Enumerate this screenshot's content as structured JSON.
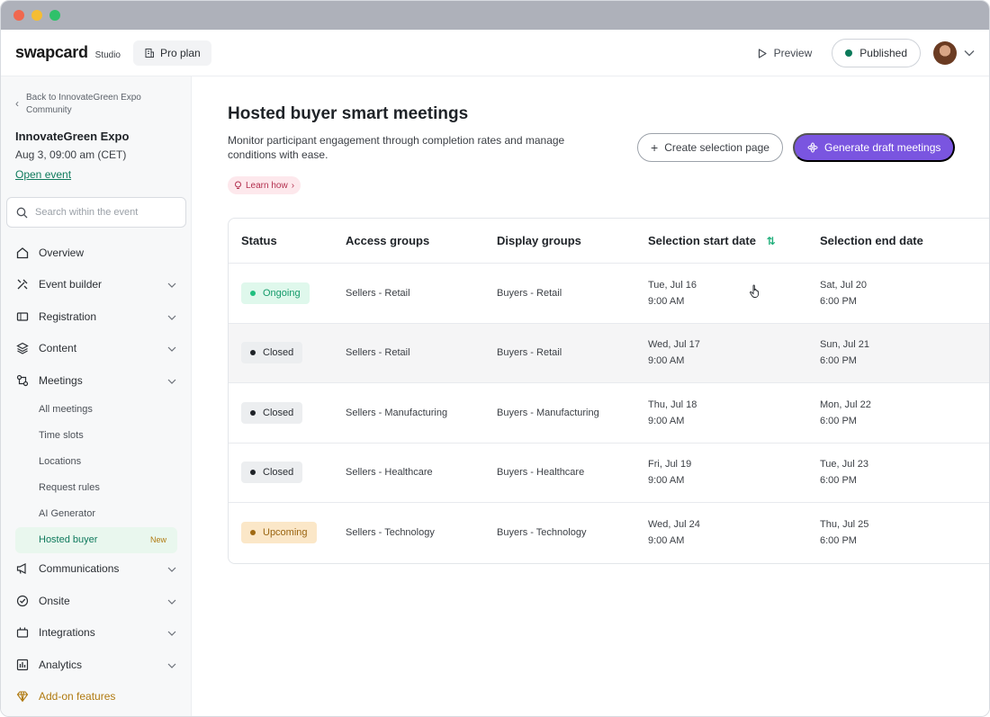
{
  "app": {
    "logo_text": "swapcard",
    "studio_label": "Studio",
    "plan_label": "Pro plan",
    "preview_label": "Preview",
    "published_label": "Published"
  },
  "sidebar": {
    "back_label": "Back to InnovateGreen Expo Community",
    "event_name": "InnovateGreen Expo",
    "event_date": "Aug 3, 09:00 am (CET)",
    "open_event_label": "Open event",
    "search_placeholder": "Search within the event",
    "items": [
      {
        "label": "Overview",
        "icon": "home-icon"
      },
      {
        "label": "Event builder",
        "icon": "tools-icon"
      },
      {
        "label": "Registration",
        "icon": "ticket-icon"
      },
      {
        "label": "Content",
        "icon": "layers-icon"
      },
      {
        "label": "Meetings",
        "icon": "meetings-icon"
      },
      {
        "label": "Communications",
        "icon": "megaphone-icon"
      },
      {
        "label": "Onsite",
        "icon": "badge-check-icon"
      },
      {
        "label": "Integrations",
        "icon": "plug-icon"
      },
      {
        "label": "Analytics",
        "icon": "chart-icon"
      },
      {
        "label": "Add-on features",
        "icon": "diamond-icon"
      }
    ],
    "meetings_sub": [
      "All meetings",
      "Time slots",
      "Locations",
      "Request rules",
      "AI Generator",
      "Hosted buyer"
    ],
    "new_badge": "New"
  },
  "main": {
    "title": "Hosted buyer smart meetings",
    "description": "Monitor participant engagement through completion rates and manage conditions with ease.",
    "learn_label": "Learn how",
    "create_btn": "Create selection page",
    "generate_btn": "Generate draft meetings"
  },
  "table": {
    "headers": [
      "Status",
      "Access groups",
      "Display groups",
      "Selection start date",
      "Selection end date"
    ],
    "rows": [
      {
        "status": "Ongoing",
        "access": "Sellers - Retail",
        "display": "Buyers - Retail",
        "start_day": "Tue, Jul 16",
        "start_time": "9:00 AM",
        "end_day": "Sat, Jul 20",
        "end_time": "6:00 PM"
      },
      {
        "status": "Closed",
        "access": "Sellers - Retail",
        "display": "Buyers - Retail",
        "start_day": "Wed, Jul 17",
        "start_time": "9:00 AM",
        "end_day": "Sun, Jul 21",
        "end_time": "6:00 PM"
      },
      {
        "status": "Closed",
        "access": "Sellers - Manufacturing",
        "display": "Buyers - Manufacturing",
        "start_day": "Thu, Jul 18",
        "start_time": "9:00 AM",
        "end_day": "Mon, Jul 22",
        "end_time": "6:00 PM"
      },
      {
        "status": "Closed",
        "access": "Sellers - Healthcare",
        "display": "Buyers - Healthcare",
        "start_day": "Fri, Jul 19",
        "start_time": "9:00 AM",
        "end_day": "Tue, Jul 23",
        "end_time": "6:00 PM"
      },
      {
        "status": "Upcoming",
        "access": "Sellers - Technology",
        "display": "Buyers - Technology",
        "start_day": "Wed, Jul 24",
        "start_time": "9:00 AM",
        "end_day": "Thu, Jul 25",
        "end_time": "6:00 PM"
      }
    ]
  },
  "colors": {
    "accent": "#7a55e0",
    "link": "#0f7a5c",
    "ongoing": "#1fbf7f",
    "upcoming": "#a06a14"
  }
}
